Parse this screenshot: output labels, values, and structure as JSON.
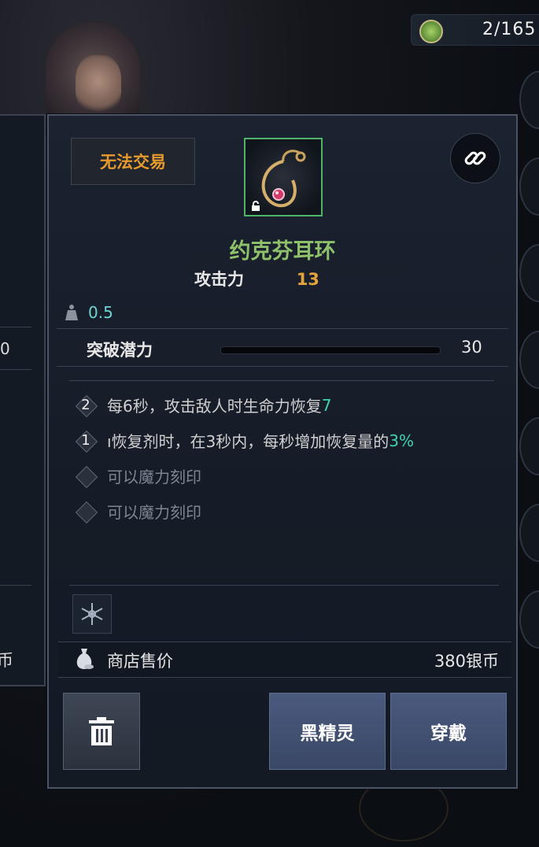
{
  "resource": {
    "count": "2/165",
    "icon": "fist-token-icon"
  },
  "left_panel": {
    "partial_value": "0",
    "partial_currency": "币"
  },
  "tooltip": {
    "trade_badge": "无法交易",
    "item_name": "约克芬耳环",
    "stats": {
      "attack_label": "攻击力",
      "attack_value": "13"
    },
    "weight": "0.5",
    "breakthrough": {
      "label": "突破潜力",
      "value": "30",
      "progress": 0
    },
    "effects": [
      {
        "level": "2",
        "text": "每6秒，攻击敌人时生命力恢复",
        "highlight": "7",
        "enabled": true
      },
      {
        "level": "1",
        "text": "ı恢复剂时，在3秒内，每秒增加恢复量的",
        "highlight": "3%",
        "enabled": true
      },
      {
        "level": "",
        "text": "可以魔力刻印",
        "highlight": "",
        "enabled": false
      },
      {
        "level": "",
        "text": "可以魔力刻印",
        "highlight": "",
        "enabled": false
      }
    ],
    "price": {
      "label": "商店售价",
      "value": "380银币"
    },
    "buttons": {
      "race": "黑精灵",
      "equip": "穿戴"
    }
  },
  "colors": {
    "item_name": "#8fc16a",
    "attack_value": "#e3a43d",
    "highlight": "#3fd3b0",
    "badge": "#e69a2e",
    "button": "#4a5a7e"
  }
}
